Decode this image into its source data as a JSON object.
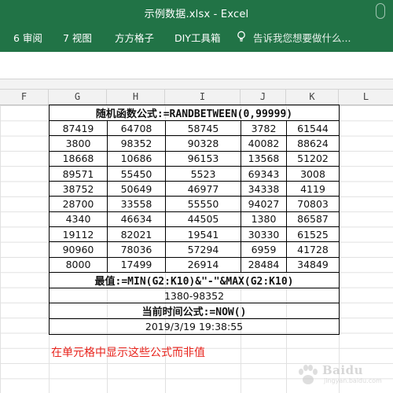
{
  "window": {
    "title": "示例数据.xlsx - Excel"
  },
  "ribbon": {
    "tabs": [
      {
        "label": "6 审阅"
      },
      {
        "label": "7 视图"
      },
      {
        "label": "方方格子"
      },
      {
        "label": "DIY工具箱"
      }
    ],
    "tell_me": "告诉我您想要做什么..."
  },
  "columns": [
    "F",
    "G",
    "H",
    "I",
    "J",
    "K",
    "L"
  ],
  "sheet": {
    "header_formula": "随机函数公式:=RANDBETWEEN(0,99999)",
    "rows": [
      [
        "87419",
        "64708",
        "58745",
        "3782",
        "61544"
      ],
      [
        "3800",
        "98352",
        "90328",
        "40082",
        "88624"
      ],
      [
        "18668",
        "10686",
        "96153",
        "13568",
        "51202"
      ],
      [
        "89571",
        "55450",
        "5523",
        "69343",
        "3008"
      ],
      [
        "38752",
        "50649",
        "46977",
        "34338",
        "4119"
      ],
      [
        "28700",
        "33558",
        "55550",
        "94027",
        "70803"
      ],
      [
        "4340",
        "46634",
        "44505",
        "1380",
        "86587"
      ],
      [
        "19112",
        "82021",
        "19541",
        "30330",
        "61525"
      ],
      [
        "90960",
        "78036",
        "57294",
        "6959",
        "41728"
      ],
      [
        "8000",
        "17499",
        "26914",
        "28484",
        "34849"
      ]
    ],
    "minmax_formula": "最值:=MIN(G2:K10)&\"-\"&MAX(G2:K10)",
    "minmax_result": "1380-98352",
    "now_formula": "当前时间公式:=NOW()",
    "now_result": "2019/3/19 19:38:55"
  },
  "note": "在单元格中显示这些公式而非值",
  "watermark": {
    "brand": "Baidu",
    "sub": "jingyan.baidu.com"
  },
  "colors": {
    "excel_green": "#217346",
    "note_red": "#e8231c"
  }
}
